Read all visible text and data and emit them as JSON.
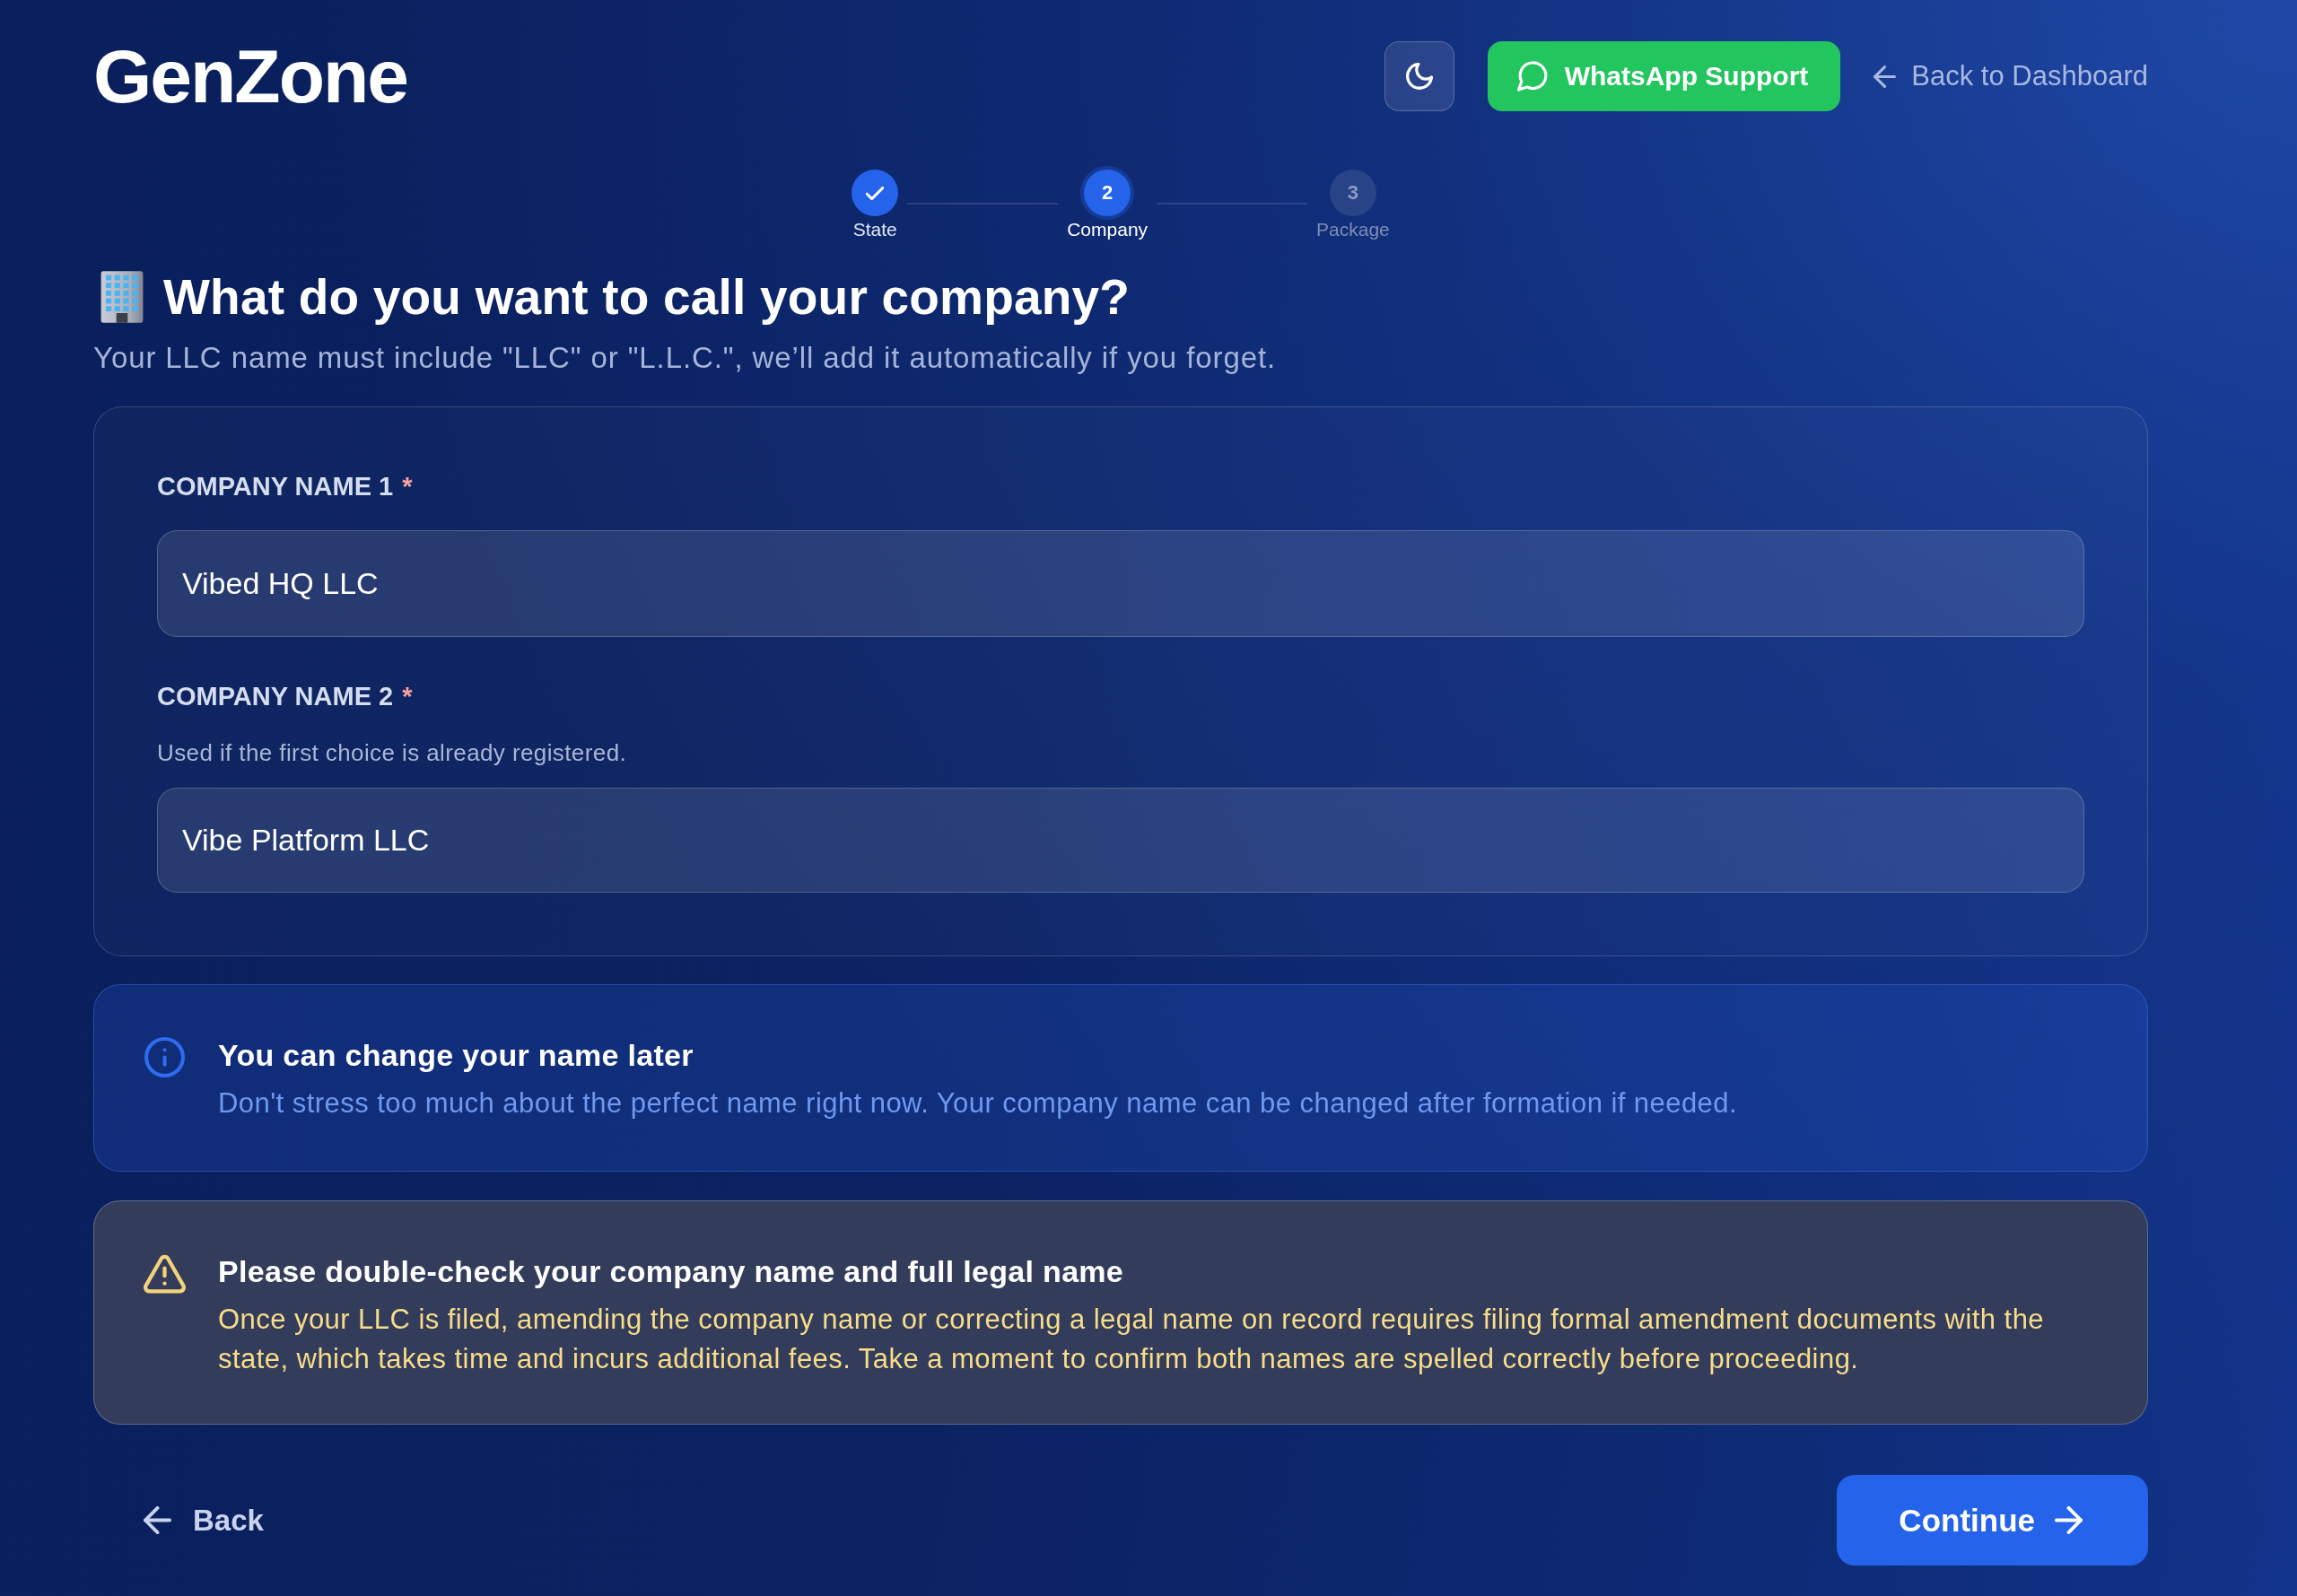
{
  "header": {
    "logo": "GenZone",
    "support_button": "WhatsApp Support",
    "back_link": "Back to Dashboard"
  },
  "steps": [
    {
      "label": "State",
      "completed": true,
      "selected": false
    },
    {
      "number": "2",
      "label": "Company",
      "completed": false,
      "selected": true
    },
    {
      "number": "3",
      "label": "Package",
      "completed": false,
      "selected": false
    }
  ],
  "page": {
    "title": "What do you want to call your company?",
    "subtitle": "Your LLC name must include \"LLC\" or \"L.L.C.\", we’ll add it automatically if you forget."
  },
  "form": {
    "fields": [
      {
        "label": "COMPANY NAME 1",
        "required_mark": "*",
        "value": "Vibed HQ LLC"
      },
      {
        "label": "COMPANY NAME 2",
        "required_mark": "*",
        "help": "Used if the first choice is already registered.",
        "value": "Vibe Platform LLC"
      }
    ]
  },
  "notices": [
    {
      "kind": "info",
      "title": "You can change your name later",
      "body": "Don't stress too much about the perfect name right now. Your company name can be changed after formation if needed."
    },
    {
      "kind": "warning",
      "title": "Please double-check your company name and full legal name",
      "body": "Once your LLC is filed, amending the company name or correcting a legal name on record requires filing formal amendment documents with the state, which takes time and incurs additional fees. Take a moment to confirm both names are spelled correctly before proceeding."
    }
  ],
  "footer": {
    "back_button": "Back",
    "continue_button": "Continue"
  }
}
